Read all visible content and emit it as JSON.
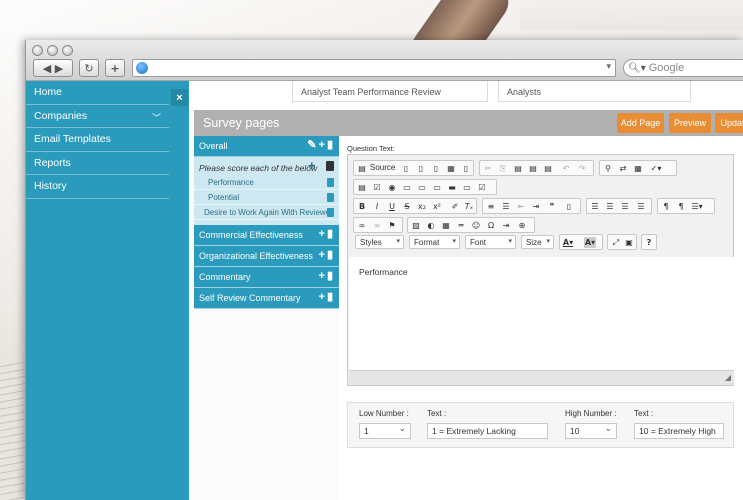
{
  "browser": {
    "search_placeholder": "Google",
    "back_label": "◀ ▶",
    "reload_label": "↻",
    "add_tab_label": "+"
  },
  "sidebar": {
    "close_label": "×",
    "items": [
      {
        "label": "Home"
      },
      {
        "label": "Companies"
      },
      {
        "label": "Email Templates"
      },
      {
        "label": "Reports"
      },
      {
        "label": "History"
      }
    ]
  },
  "top_fields": {
    "survey_name": "Analyst Team Performance Review",
    "group": "Analysts"
  },
  "survey_pages": {
    "title": "Survey pages",
    "buttons": {
      "add_page": "Add Page",
      "preview": "Preview",
      "update": "Update"
    },
    "pages": [
      {
        "label": "Overall"
      },
      {
        "label": "Commercial Effectiveness"
      },
      {
        "label": "Organizational Effectiveness"
      },
      {
        "label": "Commentary"
      },
      {
        "label": "Self Review Commentary"
      }
    ],
    "section_title": "Please score each of the below",
    "questions": [
      {
        "label": "Performance"
      },
      {
        "label": "Potential"
      },
      {
        "label": "Desire to Work Again With Reviewer"
      }
    ]
  },
  "editor": {
    "question_text_label": "Question Text:",
    "source_label": "Source",
    "combos": {
      "styles": "Styles",
      "format": "Format",
      "font": "Font",
      "size": "Size"
    },
    "content": "Performance"
  },
  "number_range": {
    "low_label": "Low Number :",
    "low_value": "1",
    "low_text_label": "Text :",
    "low_text_value": "1 = Extremely Lacking",
    "high_label": "High Number :",
    "high_value": "10",
    "high_text_label": "Text :",
    "high_text_value": "10 = Extremely High"
  },
  "colors": {
    "accent": "#2a9bbc",
    "button": "#e98d34",
    "header": "#b0b0b0"
  }
}
